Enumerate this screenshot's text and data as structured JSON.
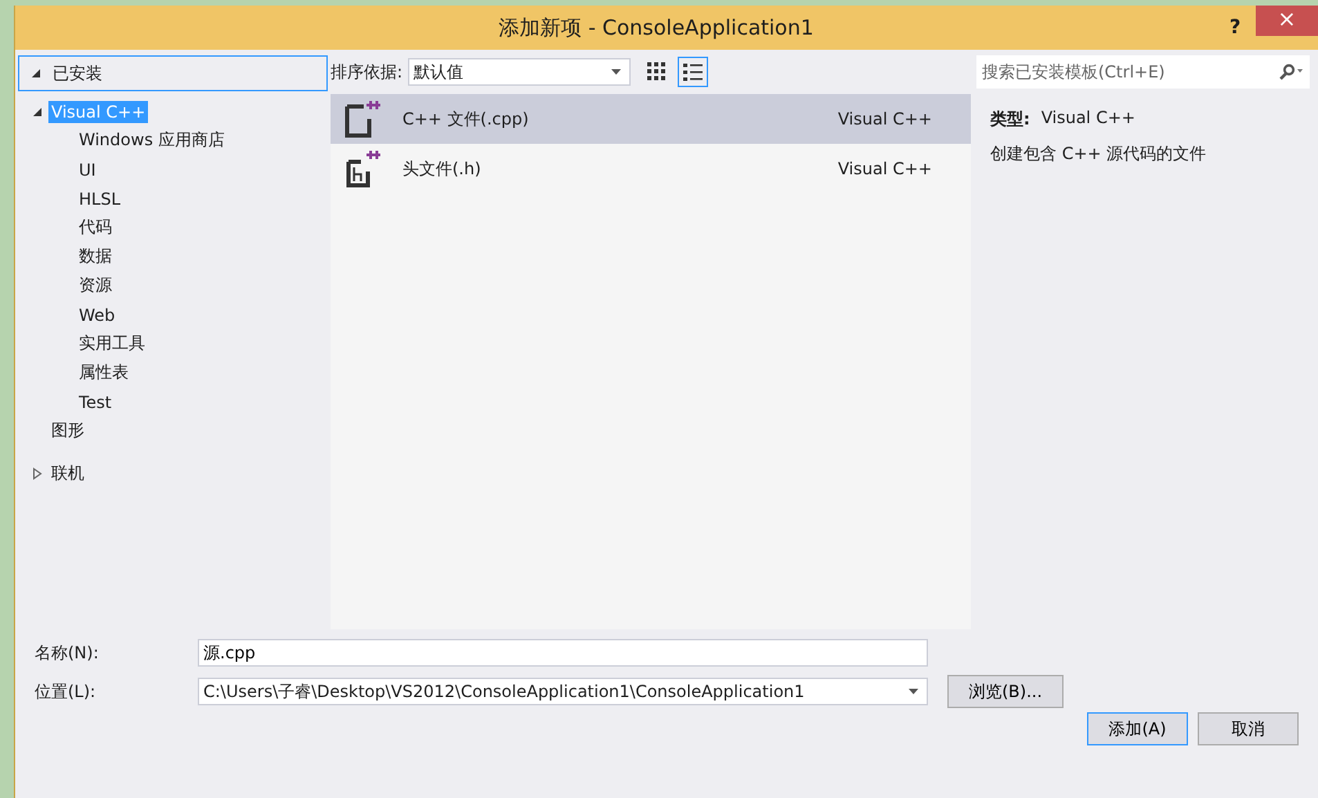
{
  "window": {
    "title": "添加新项 - ConsoleApplication1",
    "help": "?",
    "close": "×"
  },
  "installed_header": {
    "label": "已安装",
    "expanded": true
  },
  "tree": [
    {
      "label": "Visual C++",
      "expanded": true,
      "selected": true,
      "children": [
        {
          "label": "Windows 应用商店",
          "selected": false
        },
        {
          "label": "UI",
          "selected": false
        },
        {
          "label": "HLSL",
          "selected": false
        },
        {
          "label": "代码",
          "selected": false
        },
        {
          "label": "数据",
          "selected": false
        },
        {
          "label": "资源",
          "selected": false
        },
        {
          "label": "Web",
          "selected": false
        },
        {
          "label": "实用工具",
          "selected": false
        },
        {
          "label": "属性表",
          "selected": false
        },
        {
          "label": "Test",
          "selected": false
        }
      ]
    },
    {
      "label": "图形",
      "selected": false
    },
    {
      "label": "联机",
      "expanded": false,
      "selected": false
    }
  ],
  "sort": {
    "label": "排序依据:",
    "value": "默认值"
  },
  "view_buttons": [
    {
      "kind": "grid",
      "selected": false
    },
    {
      "kind": "list",
      "selected": true
    }
  ],
  "search": {
    "placeholder": "搜索已安装模板(Ctrl+E)"
  },
  "templates": [
    {
      "kind": "cpp",
      "name": "C++ 文件(.cpp)",
      "type": "Visual C++",
      "selected": true
    },
    {
      "kind": "header",
      "name": "头文件(.h)",
      "type": "Visual C++",
      "selected": false
    }
  ],
  "details": {
    "type_label": "类型:",
    "type_value": "Visual C++",
    "description": "创建包含 C++ 源代码的文件"
  },
  "name_field": {
    "label": "名称(N):",
    "value": "源.cpp"
  },
  "location_field": {
    "label": "位置(L):",
    "value": "C:\\Users\\子睿\\Desktop\\VS2012\\ConsoleApplication1\\ConsoleApplication1"
  },
  "browse_button": "浏览(B)...",
  "buttons": [
    {
      "label": "添加(A)",
      "default": true
    },
    {
      "label": "取消",
      "default": false
    }
  ]
}
